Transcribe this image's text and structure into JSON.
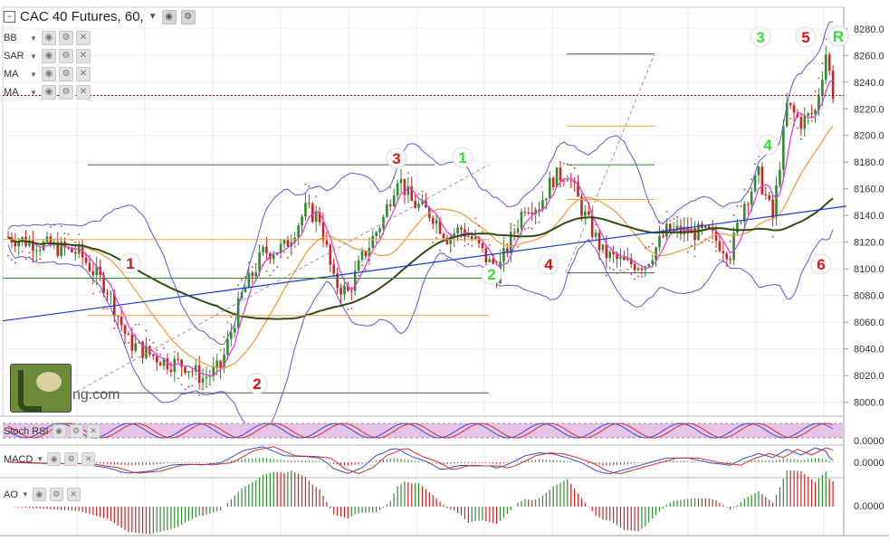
{
  "header": {
    "title": "CAC 40 Futures, 60,",
    "eye_icon": "eye-icon",
    "settings_icon": "gear-icon"
  },
  "indicators": [
    {
      "name": "BB"
    },
    {
      "name": "SAR"
    },
    {
      "name": "MA"
    },
    {
      "name": "MA"
    }
  ],
  "price_axis": {
    "labels": [
      "8280.0",
      "8260.0",
      "8240.0",
      "8220.0",
      "8200.0",
      "8180.0",
      "8160.0",
      "8140.0",
      "8120.0",
      "8100.0",
      "8080.0",
      "8060.0",
      "8040.0",
      "8020.0",
      "8000.0"
    ]
  },
  "panels": {
    "stoch": {
      "name": "Stoch RSI",
      "axis_value": "0.0000"
    },
    "macd": {
      "name": "MACD",
      "axis_value": "0.0000"
    },
    "ao": {
      "name": "AO",
      "axis_value": "0.0000"
    }
  },
  "logo": {
    "text": "ng.com"
  },
  "colors": {
    "up": "#2e8b2e",
    "down": "#cc2222",
    "bb": "#5a5ad8",
    "sar": "#e03030",
    "ma_fast": "#e040e0",
    "ma_mid": "#f0a040",
    "ma_slow": "#2d4d14",
    "trend": "#1a3acc",
    "green_label": "#3dd83d",
    "red_label": "#dd1111",
    "stoch_band": "#e7c4e7"
  },
  "annotations": {
    "red": [
      "1",
      "2",
      "3",
      "4",
      "5",
      "6"
    ],
    "green": [
      "1",
      "2",
      "3",
      "4",
      "R"
    ]
  },
  "chart_data": {
    "type": "candlestick",
    "title": "CAC 40 Futures, 60,",
    "ylim": [
      7995,
      8288
    ],
    "last_price": 8230,
    "candles": []
  }
}
